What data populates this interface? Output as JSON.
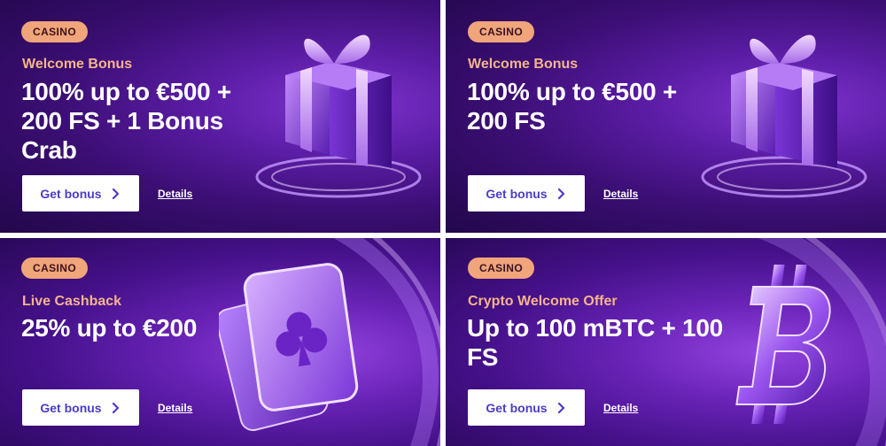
{
  "cards": [
    {
      "badge": "CASINO",
      "subtitle": "Welcome Bonus",
      "headline": "100% up to €500 + 200 FS + 1 Bonus Crab",
      "button_label": "Get bonus",
      "details_label": "Details",
      "art_icon": "gift-icon"
    },
    {
      "badge": "CASINO",
      "subtitle": "Welcome Bonus",
      "headline": "100% up to €500 + 200 FS",
      "button_label": "Get bonus",
      "details_label": "Details",
      "art_icon": "gift-icon"
    },
    {
      "badge": "CASINO",
      "subtitle": "Live Cashback",
      "headline": "25% up to €200",
      "button_label": "Get bonus",
      "details_label": "Details",
      "art_icon": "playing-cards-icon"
    },
    {
      "badge": "CASINO",
      "subtitle": "Crypto Welcome Offer",
      "headline": "Up to 100 mBTC + 100 FS",
      "button_label": "Get bonus",
      "details_label": "Details",
      "art_icon": "bitcoin-icon"
    }
  ],
  "colors": {
    "badge_bg": "#f0a57a",
    "subtitle": "#f6b48c",
    "button_text": "#4b3cc8",
    "card_bg": "#3a0f73"
  }
}
